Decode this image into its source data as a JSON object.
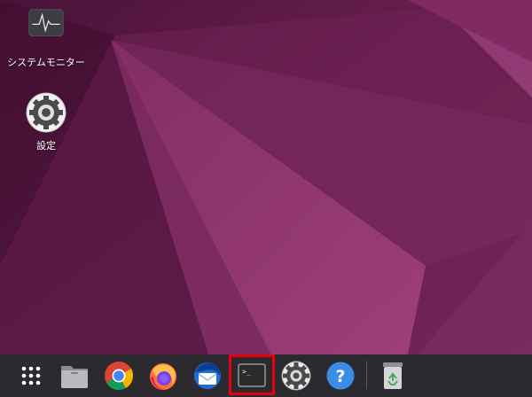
{
  "desktop": {
    "icons": [
      {
        "label": "システムモニター",
        "icon": "system-monitor-icon"
      },
      {
        "label": "設定",
        "icon": "settings-gear-icon"
      }
    ]
  },
  "dock": {
    "items": [
      {
        "icon": "app-grid-icon"
      },
      {
        "icon": "files-folder-icon"
      },
      {
        "icon": "chrome-icon"
      },
      {
        "icon": "firefox-icon"
      },
      {
        "icon": "thunderbird-icon"
      },
      {
        "icon": "terminal-icon",
        "highlighted": true
      },
      {
        "icon": "settings-gear-icon"
      },
      {
        "icon": "help-icon",
        "glyph": "?"
      },
      {
        "icon": "trash-icon"
      }
    ],
    "terminal_prompt": ">_"
  },
  "colors": {
    "wallpaper_base": "#6b2150",
    "dock_background": "#2c2a2e",
    "highlight": "#e8000f",
    "help_blue": "#3a8ee6"
  }
}
